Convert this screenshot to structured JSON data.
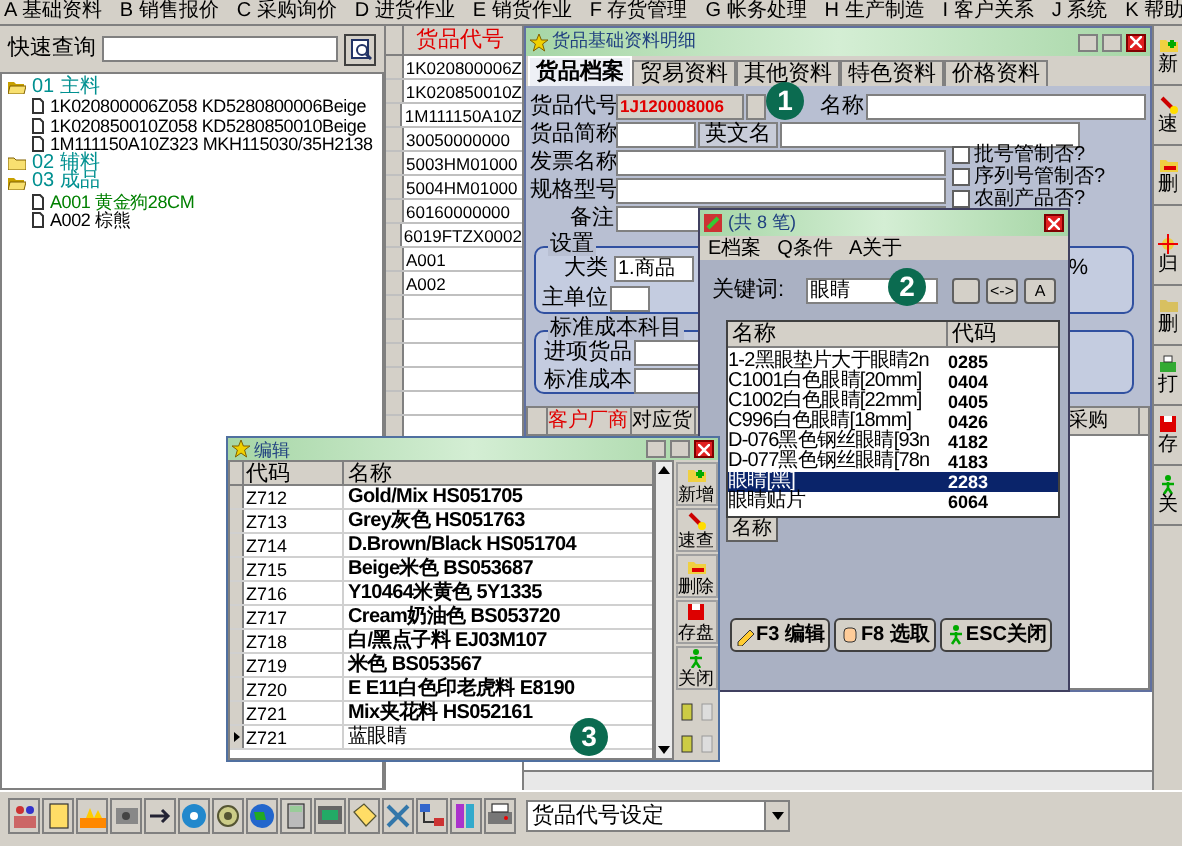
{
  "menu_bar": [
    "A 基础资料",
    "B 销售报价",
    "C 采购询价",
    "D 进货作业",
    "E 销货作业",
    "F 存货管理",
    "G 帐务处理",
    "H 生产制造",
    "I 客户关系",
    "J 系统",
    "K 帮助"
  ],
  "quick_search": {
    "label": "快速查询"
  },
  "tree": [
    {
      "label": "01 主料",
      "expanded": true,
      "children": [
        {
          "label": "1K020800006Z058 KD5280800006Beige",
          "selected": false
        },
        {
          "label": "1K020850010Z058 KD5280850010Beige",
          "selected": false
        },
        {
          "label": "1M111150A10Z323 MKH115030/35H2138",
          "selected": false
        }
      ]
    },
    {
      "label": "02 辅料",
      "expanded": false
    },
    {
      "label": "03 成品",
      "expanded": true,
      "children": [
        {
          "label": "A001 黄金狗28CM",
          "selected": true
        },
        {
          "label": "A002 棕熊",
          "selected": false
        }
      ]
    }
  ],
  "code_list": {
    "header": "货品代号",
    "rows": [
      "1K020800006Z",
      "1K020850010Z",
      "1M111150A10Z",
      "30050000000",
      "5003HM01000",
      "5004HM01000",
      "60160000000",
      "6019FTZX0002",
      "A001",
      "A002"
    ]
  },
  "main_window": {
    "title": "货品基础资料明细",
    "tabs": [
      {
        "label": "货品档案",
        "selected": true
      },
      {
        "label": "贸易资料",
        "selected": false
      },
      {
        "label": "其他资料",
        "selected": false
      },
      {
        "label": "特色资料",
        "selected": false
      },
      {
        "label": "价格资料",
        "selected": false
      }
    ],
    "code_label": "货品代号",
    "code_value": "1J120008006",
    "name_label": "名称",
    "short_name_label": "货品简称",
    "english_name_button": "英文名",
    "fields": [
      "发票名称",
      "规格型号",
      "备注"
    ],
    "checkboxes": [
      {
        "label": "批号管制否?",
        "checked": false
      },
      {
        "label": "序列号管制否?",
        "checked": false
      },
      {
        "label": "农副产品否?",
        "checked": false
      }
    ],
    "settings": {
      "title": "设置",
      "category_label": "大类",
      "category_value": "1.商品",
      "unit_label": "主单位",
      "percent": "%"
    },
    "cost": {
      "title": "标准成本科目",
      "fields": [
        "进项货品",
        "标准成本"
      ]
    },
    "grid_columns": [
      "客户厂商",
      "对应货",
      "采购"
    ],
    "badge": "1"
  },
  "search_dialog": {
    "title": "(共 8 笔)",
    "menu": [
      "E档案",
      "Q条件",
      "A关于"
    ],
    "keyword_label": "关键词:",
    "keyword": "眼睛",
    "option_buttons": [
      "<->",
      "A"
    ],
    "columns": [
      "名称",
      "代码"
    ],
    "rows": [
      {
        "name": "1-2黑眼垫片大于眼睛2n",
        "code": "0285",
        "selected": false
      },
      {
        "name": "C1001白色眼睛[20mm]",
        "code": "0404",
        "selected": false
      },
      {
        "name": "C1002白色眼睛[22mm]",
        "code": "0405",
        "selected": false
      },
      {
        "name": "C996白色眼睛[18mm]",
        "code": "0426",
        "selected": false
      },
      {
        "name": "D-076黑色钢丝眼睛[93n",
        "code": "4182",
        "selected": false
      },
      {
        "name": "D-077黑色钢丝眼睛[78n",
        "code": "4183",
        "selected": false
      },
      {
        "name": "眼睛[黑]",
        "code": "2283",
        "selected": true
      },
      {
        "name": "眼睛贴片",
        "code": "6064",
        "selected": false
      }
    ],
    "tab": "名称",
    "buttons": [
      "F3 编辑",
      "F8 选取",
      "ESC关闭"
    ],
    "badge": "2"
  },
  "edit_window": {
    "title": "编辑",
    "columns": [
      "代码",
      "名称"
    ],
    "rows": [
      {
        "code": "Z712",
        "name": "Gold/Mix HS051705",
        "current": false
      },
      {
        "code": "Z713",
        "name": "Grey灰色 HS051763",
        "current": false
      },
      {
        "code": "Z714",
        "name": "D.Brown/Black HS051704",
        "current": false
      },
      {
        "code": "Z715",
        "name": "Beige米色 BS053687",
        "current": false
      },
      {
        "code": "Z716",
        "name": "Y10464米黄色 5Y1335",
        "current": false
      },
      {
        "code": "Z717",
        "name": "Cream奶油色 BS053720",
        "current": false
      },
      {
        "code": "Z718",
        "name": "白/黑点子料 EJ03M107",
        "current": false
      },
      {
        "code": "Z719",
        "name": "米色 BS053567",
        "current": false
      },
      {
        "code": "Z720",
        "name": "E E11白色印老虎料 E8190",
        "current": false
      },
      {
        "code": "Z721",
        "name": "Mix夹花料 HS052161",
        "current": false
      },
      {
        "code": "Z721",
        "name": "蓝眼睛",
        "current": true
      }
    ],
    "tools": [
      "新增",
      "速查",
      "删除",
      "存盘",
      "关闭"
    ],
    "badge": "3"
  },
  "right_toolbar": [
    "新",
    "速",
    "删",
    "归",
    "删",
    "打",
    "存",
    "关"
  ],
  "bottom_toolbar": {
    "dropdown": "货品代号设定"
  }
}
